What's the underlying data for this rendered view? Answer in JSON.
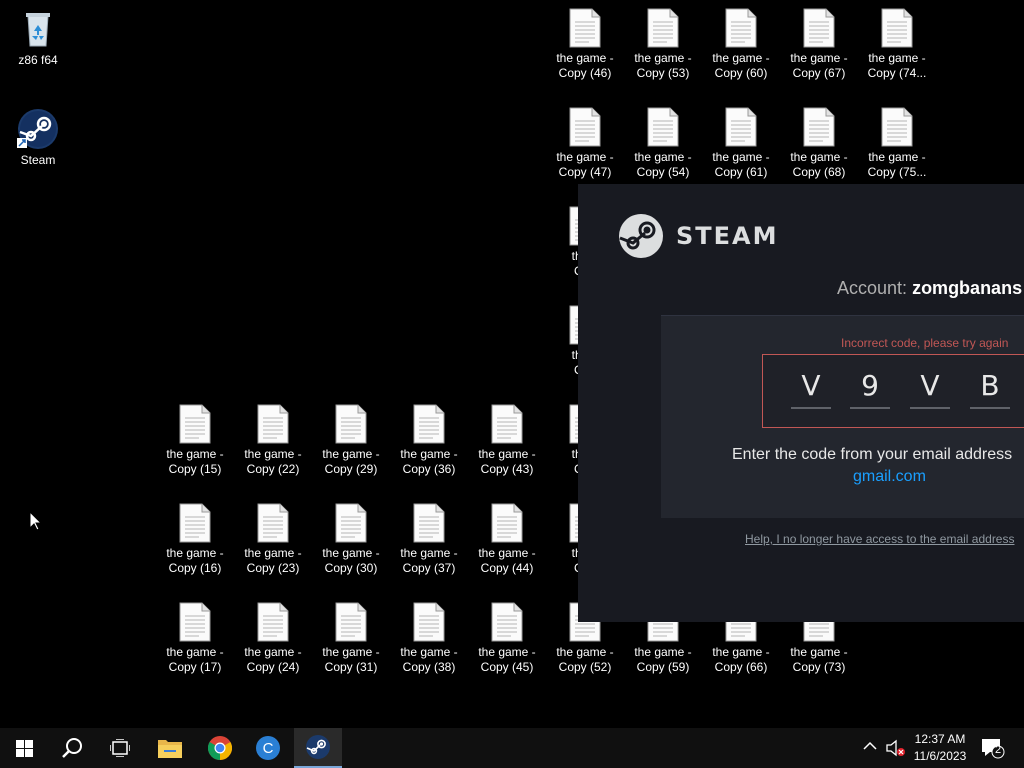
{
  "desktop": {
    "system_icons": [
      {
        "label": "z86 f64",
        "icon": "recycle-bin-icon"
      },
      {
        "label": "Steam",
        "icon": "steam-icon"
      }
    ],
    "files": [
      {
        "col": 0,
        "row": 0,
        "line1": "the game -",
        "line2": "Copy (46)"
      },
      {
        "col": 1,
        "row": 0,
        "line1": "the game -",
        "line2": "Copy (53)"
      },
      {
        "col": 2,
        "row": 0,
        "line1": "the game -",
        "line2": "Copy (60)"
      },
      {
        "col": 3,
        "row": 0,
        "line1": "the game -",
        "line2": "Copy (67)"
      },
      {
        "col": 4,
        "row": 0,
        "line1": "the game -",
        "line2": "Copy (74..."
      },
      {
        "col": 0,
        "row": 1,
        "line1": "the game -",
        "line2": "Copy (47)"
      },
      {
        "col": 1,
        "row": 1,
        "line1": "the game -",
        "line2": "Copy (54)"
      },
      {
        "col": 2,
        "row": 1,
        "line1": "the game -",
        "line2": "Copy (61)"
      },
      {
        "col": 3,
        "row": 1,
        "line1": "the game -",
        "line2": "Copy (68)"
      },
      {
        "col": 4,
        "row": 1,
        "line1": "the game -",
        "line2": "Copy (75..."
      },
      {
        "col": 0,
        "row": 2,
        "line1": "the g",
        "line2": "Cop"
      },
      {
        "col": 0,
        "row": 3,
        "line1": "the g",
        "line2": "Cop"
      },
      {
        "col": -5,
        "row": 4,
        "line1": "the game -",
        "line2": "Copy (15)"
      },
      {
        "col": -4,
        "row": 4,
        "line1": "the game -",
        "line2": "Copy (22)"
      },
      {
        "col": -3,
        "row": 4,
        "line1": "the game -",
        "line2": "Copy (29)"
      },
      {
        "col": -2,
        "row": 4,
        "line1": "the game -",
        "line2": "Copy (36)"
      },
      {
        "col": -1,
        "row": 4,
        "line1": "the game -",
        "line2": "Copy (43)"
      },
      {
        "col": 0,
        "row": 4,
        "line1": "the g",
        "line2": "Cop"
      },
      {
        "col": -5,
        "row": 5,
        "line1": "the game -",
        "line2": "Copy (16)"
      },
      {
        "col": -4,
        "row": 5,
        "line1": "the game -",
        "line2": "Copy (23)"
      },
      {
        "col": -3,
        "row": 5,
        "line1": "the game -",
        "line2": "Copy (30)"
      },
      {
        "col": -2,
        "row": 5,
        "line1": "the game -",
        "line2": "Copy (37)"
      },
      {
        "col": -1,
        "row": 5,
        "line1": "the game -",
        "line2": "Copy (44)"
      },
      {
        "col": 0,
        "row": 5,
        "line1": "the g",
        "line2": "Cop"
      },
      {
        "col": -5,
        "row": 6,
        "line1": "the game -",
        "line2": "Copy (17)"
      },
      {
        "col": -4,
        "row": 6,
        "line1": "the game -",
        "line2": "Copy (24)"
      },
      {
        "col": -3,
        "row": 6,
        "line1": "the game -",
        "line2": "Copy (31)"
      },
      {
        "col": -2,
        "row": 6,
        "line1": "the game -",
        "line2": "Copy (38)"
      },
      {
        "col": -1,
        "row": 6,
        "line1": "the game -",
        "line2": "Copy (45)"
      },
      {
        "col": 0,
        "row": 6,
        "line1": "the game -",
        "line2": "Copy (52)"
      },
      {
        "col": 1,
        "row": 6,
        "line1": "the game -",
        "line2": "Copy (59)"
      },
      {
        "col": 2,
        "row": 6,
        "line1": "the game -",
        "line2": "Copy (66)"
      },
      {
        "col": 3,
        "row": 6,
        "line1": "the game -",
        "line2": "Copy (73)"
      }
    ]
  },
  "steam_dialog": {
    "brand": "STEAM",
    "account_label": "Account:",
    "account_name": "zomgbanans",
    "error": "Incorrect code, please try again",
    "code_chars": [
      "V",
      "9",
      "V",
      "B"
    ],
    "instruction": "Enter the code from your email address",
    "email_domain": "gmail.com",
    "help_link": "Help, I no longer have access to the email address"
  },
  "taskbar": {
    "buttons": [
      {
        "name": "start-button",
        "icon": "windows-logo-icon"
      },
      {
        "name": "search-button",
        "icon": "search-icon"
      },
      {
        "name": "task-view-button",
        "icon": "task-view-icon"
      },
      {
        "name": "file-explorer-button",
        "icon": "folder-icon"
      },
      {
        "name": "chrome-button",
        "icon": "chrome-icon"
      },
      {
        "name": "app-c-button",
        "icon": "c-app-icon"
      },
      {
        "name": "steam-taskbar-button",
        "icon": "steam-icon",
        "active": true
      }
    ],
    "time": "12:37 AM",
    "date": "11/6/2023",
    "notification_count": "2"
  },
  "colors": {
    "desktop_bg": "#000000",
    "dialog_bg": "#181a21",
    "panel_bg": "#23262e",
    "error": "#c15755",
    "link_blue": "#1a9fff",
    "taskbar_bg": "#101010"
  }
}
